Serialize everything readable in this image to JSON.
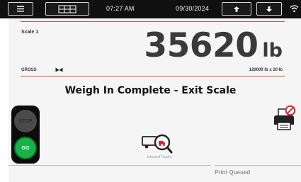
{
  "topbar": {
    "time": "07:27 AM",
    "date": "09/30/2024",
    "menu_icon": "hamburger-menu-icon",
    "scales_icon": "scales-grid-icon",
    "up_icon": "arrow-up-icon",
    "down_icon": "arrow-down-icon",
    "wifi_icon": "wifi-icon"
  },
  "scale": {
    "name": "Scale 1",
    "weight": "35620",
    "unit": "lb",
    "mode": "GROSS",
    "zero_indicator_icon": "center-of-zero-icon",
    "capacity": "120000 lb x 20 lb"
  },
  "status_message": "Weigh In Complete - Exit Scale",
  "traffic_light": {
    "stop_label": "STOP",
    "go_label": "GO",
    "stop_color": "#4a4a4a",
    "go_color": "#19b24a"
  },
  "inbound_trucks": {
    "label": "Inbound Trucks",
    "icon": "truck-search-icon"
  },
  "printer": {
    "icon": "printer-error-icon",
    "status": "Print Queued"
  },
  "colors": {
    "accent_rule": "#d84a56",
    "topbar_bg": "#101010",
    "alert_red": "#d6262e"
  }
}
